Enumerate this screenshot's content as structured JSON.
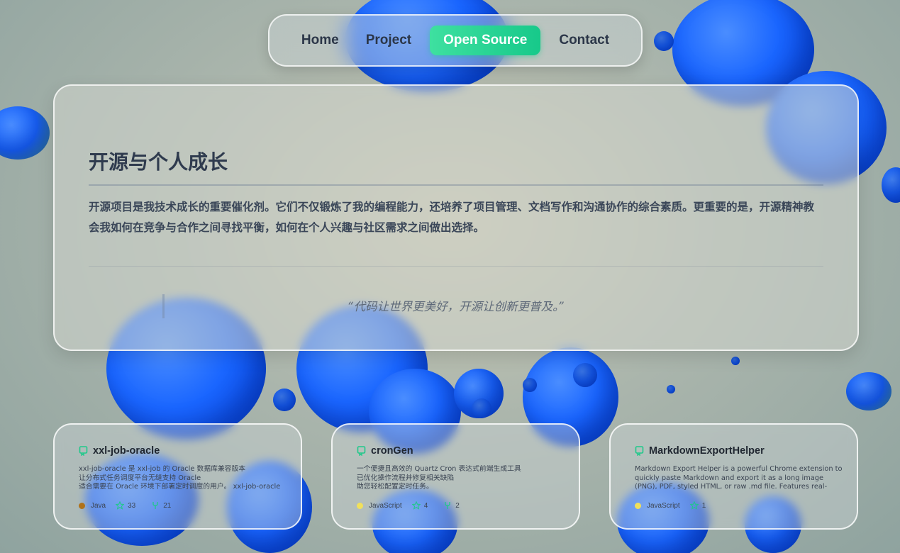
{
  "nav": {
    "items": [
      {
        "label": "Home",
        "active": false
      },
      {
        "label": "Project",
        "active": false
      },
      {
        "label": "Open Source",
        "active": true
      },
      {
        "label": "Contact",
        "active": false
      }
    ],
    "accent_color": "#17c98a"
  },
  "hero": {
    "title": "开源与个人成长",
    "body": "开源项目是我技术成长的重要催化剂。它们不仅锻炼了我的编程能力，还培养了项目管理、文档写作和沟通协作的综合素质。更重要的是，开源精神教会我如何在竞争与合作之间寻找平衡，如何在个人兴趣与社区需求之间做出选择。",
    "quote": "“代码让世界更美好，开源让创新更普及。”"
  },
  "repos": [
    {
      "name": "xxl-job-oracle",
      "description": "xxl-job-oracle 是 xxl-job 的 Oracle 数据库兼容版本\n让分布式任务调度平台无缝支持 Oracle\n适合需要在 Oracle 环境下部署定时调度的用户。 xxl-job-oracle",
      "language": "Java",
      "language_color": "#b07219",
      "stars": "33",
      "forks": "21",
      "icons": [
        "repo-icon",
        "star-icon",
        "fork-icon"
      ]
    },
    {
      "name": "cronGen",
      "description": "一个便捷且高效的 Quartz Cron 表达式前端生成工具\n已优化操作流程并修复相关缺陷\n助您轻松配置定时任务。",
      "language": "JavaScript",
      "language_color": "#f1e05a",
      "stars": "4",
      "forks": "2",
      "icons": [
        "repo-icon",
        "star-icon",
        "fork-icon"
      ]
    },
    {
      "name": "MarkdownExportHelper",
      "description": "Markdown Export Helper is a powerful Chrome extension to quickly paste Markdown and export it as a long image (PNG), PDF, styled HTML, or raw .md file. Features real-time…",
      "language": "JavaScript",
      "language_color": "#f1e05a",
      "stars": "1",
      "forks": "",
      "icons": [
        "repo-icon",
        "star-icon"
      ]
    }
  ]
}
